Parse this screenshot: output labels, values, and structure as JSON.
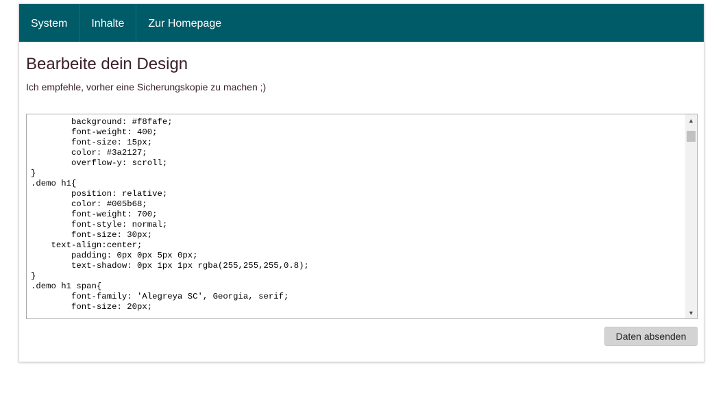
{
  "nav": {
    "items": [
      {
        "label": "System"
      },
      {
        "label": "Inhalte"
      },
      {
        "label": "Zur Homepage"
      }
    ]
  },
  "colors": {
    "navbar": "#005b68",
    "text": "#3a2127",
    "button": "#d3d3d3"
  },
  "main": {
    "title": "Bearbeite dein Design",
    "subtitle": "Ich empfehle, vorher eine Sicherungskopie zu machen ;)"
  },
  "editor": {
    "code": "        background: #f8fafe;\n        font-weight: 400;\n        font-size: 15px;\n        color: #3a2127;\n        overflow-y: scroll;\n}\n.demo h1{\n        position: relative;\n        color: #005b68;\n        font-weight: 700;\n        font-style: normal;\n        font-size: 30px;\n    text-align:center;\n        padding: 0px 0px 5px 0px;\n        text-shadow: 0px 1px 1px rgba(255,255,255,0.8);\n}\n.demo h1 span{\n        font-family: 'Alegreya SC', Georgia, serif;\n        font-size: 20px;"
  },
  "icons": {
    "scroll_up": "▲",
    "scroll_down": "▼"
  },
  "form": {
    "submit_label": "Daten absenden"
  }
}
